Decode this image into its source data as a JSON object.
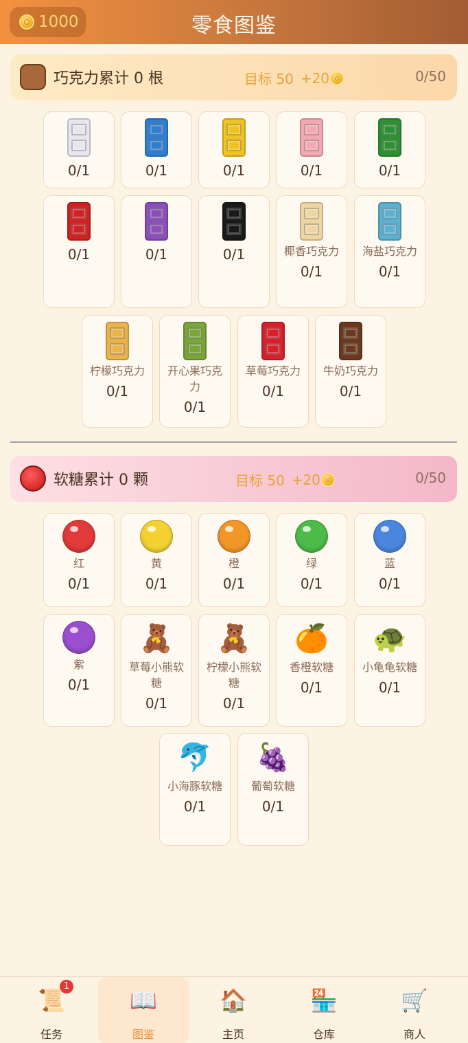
{
  "header": {
    "coins": "1000",
    "title": "零食图鉴"
  },
  "sections": [
    {
      "id": "chocolate",
      "title": "巧克力累计 0 根",
      "target": "目标 50",
      "reward": "+20",
      "progress": "0/50",
      "items": [
        {
          "name": "",
          "count": "0/1",
          "color": "#e6e6ec"
        },
        {
          "name": "",
          "count": "0/1",
          "color": "#2f7ed0"
        },
        {
          "name": "",
          "count": "0/1",
          "color": "#f0c420"
        },
        {
          "name": "",
          "count": "0/1",
          "color": "#f2a9b0"
        },
        {
          "name": "",
          "count": "0/1",
          "color": "#2f8f35"
        },
        {
          "name": "",
          "count": "0/1",
          "color": "#cf2323"
        },
        {
          "name": "",
          "count": "0/1",
          "color": "#8a4fb8"
        },
        {
          "name": "",
          "count": "0/1",
          "color": "#1a1a1a"
        },
        {
          "name": "椰香巧克力",
          "count": "0/1",
          "color": "#eed6a2"
        },
        {
          "name": "海盐巧克力",
          "count": "0/1",
          "color": "#5fb0cf"
        },
        {
          "name": "柠檬巧克力",
          "count": "0/1",
          "color": "#e9b24a"
        },
        {
          "name": "开心果巧克力",
          "count": "0/1",
          "color": "#7aa53a"
        },
        {
          "name": "草莓巧克力",
          "count": "0/1",
          "color": "#d8202c"
        },
        {
          "name": "牛奶巧克力",
          "count": "0/1",
          "color": "#6b3a1e"
        }
      ]
    },
    {
      "id": "gummy",
      "title": "软糖累计 0 颗",
      "target": "目标 50",
      "reward": "+20",
      "progress": "0/50",
      "items": [
        {
          "name": "红",
          "count": "0/1",
          "color": "#e03a3a",
          "icon": "red-candy-icon"
        },
        {
          "name": "黄",
          "count": "0/1",
          "color": "#f2d232",
          "icon": "yellow-candy-icon"
        },
        {
          "name": "橙",
          "count": "0/1",
          "color": "#f2962a",
          "icon": "orange-candy-icon"
        },
        {
          "name": "绿",
          "count": "0/1",
          "color": "#4dbb4a",
          "icon": "green-candy-icon"
        },
        {
          "name": "蓝",
          "count": "0/1",
          "color": "#4a86de",
          "icon": "blue-candy-icon"
        },
        {
          "name": "紫",
          "count": "0/1",
          "color": "#9a4ed0",
          "icon": "purple-candy-icon"
        },
        {
          "name": "草莓小熊软糖",
          "count": "0/1",
          "glyph": "🧸",
          "icon": "strawberry-bear-icon"
        },
        {
          "name": "柠檬小熊软糖",
          "count": "0/1",
          "glyph": "🧸",
          "icon": "lemon-bear-icon"
        },
        {
          "name": "香橙软糖",
          "count": "0/1",
          "glyph": "🍊",
          "icon": "orange-slice-icon"
        },
        {
          "name": "小龟龟软糖",
          "count": "0/1",
          "glyph": "🐢",
          "icon": "turtle-icon"
        },
        {
          "name": "小海豚软糖",
          "count": "0/1",
          "glyph": "🐬",
          "icon": "dolphin-icon"
        },
        {
          "name": "葡萄软糖",
          "count": "0/1",
          "glyph": "🍇",
          "icon": "grape-icon"
        }
      ]
    }
  ],
  "bottom_nav": [
    {
      "label": "任务",
      "icon": "task-scroll-icon",
      "badge": "1",
      "glyph": "📜"
    },
    {
      "label": "图鉴",
      "icon": "collection-book-icon",
      "active": true,
      "glyph": "📖"
    },
    {
      "label": "主页",
      "icon": "home-house-icon",
      "glyph": "🏠"
    },
    {
      "label": "仓库",
      "icon": "warehouse-icon",
      "glyph": "🏪"
    },
    {
      "label": "商人",
      "icon": "merchant-cart-icon",
      "glyph": "🛒"
    }
  ]
}
